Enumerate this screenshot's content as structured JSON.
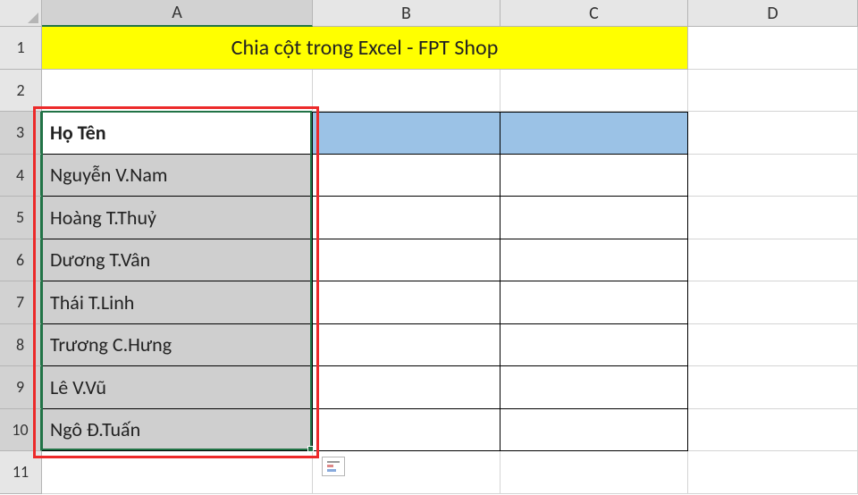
{
  "columns": [
    "A",
    "B",
    "C",
    "D"
  ],
  "rowCount": 11,
  "title": "Chia cột trong Excel - FPT Shop",
  "header": "Họ Tên",
  "names": [
    "Nguyễn V.Nam",
    "Hoàng T.Thuỷ",
    "Dương T.Vân",
    "Thái T.Linh",
    "Trương C.Hưng",
    "Lê V.Vũ",
    "Ngô Đ.Tuấn"
  ],
  "selection": {
    "col": "A",
    "startRow": 3,
    "endRow": 10
  },
  "layout": {
    "rowHdrW": 47,
    "colA": 303,
    "colB": 210,
    "colC": 210,
    "colD": 190,
    "hdrH": 30,
    "rowH": 47.5
  }
}
